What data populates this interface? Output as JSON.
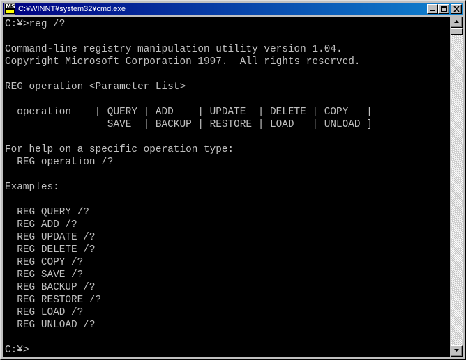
{
  "window": {
    "title": "C:¥WINNT¥system32¥cmd.exe",
    "icon": "ms-dos-icon",
    "icon_text": "MS"
  },
  "title_buttons": {
    "minimize": "minimize-icon",
    "maximize": "maximize-icon",
    "close": "close-icon"
  },
  "console": {
    "lines": [
      "C:¥>reg /?",
      "",
      "Command-line registry manipulation utility version 1.04.",
      "Copyright Microsoft Corporation 1997.  All rights reserved.",
      "",
      "REG operation <Parameter List>",
      "",
      "  operation    [ QUERY | ADD    | UPDATE  | DELETE | COPY   |",
      "                 SAVE  | BACKUP | RESTORE | LOAD   | UNLOAD ]",
      "",
      "For help on a specific operation type:",
      "  REG operation /?",
      "",
      "Examples:",
      "",
      "  REG QUERY /?",
      "  REG ADD /?",
      "  REG UPDATE /?",
      "  REG DELETE /?",
      "  REG COPY /?",
      "  REG SAVE /?",
      "  REG BACKUP /?",
      "  REG RESTORE /?",
      "  REG LOAD /?",
      "  REG UNLOAD /?",
      "",
      "C:¥>"
    ]
  },
  "colors": {
    "console_bg": "#000000",
    "console_fg": "#c0c0c0",
    "title_bg": "#000080"
  }
}
